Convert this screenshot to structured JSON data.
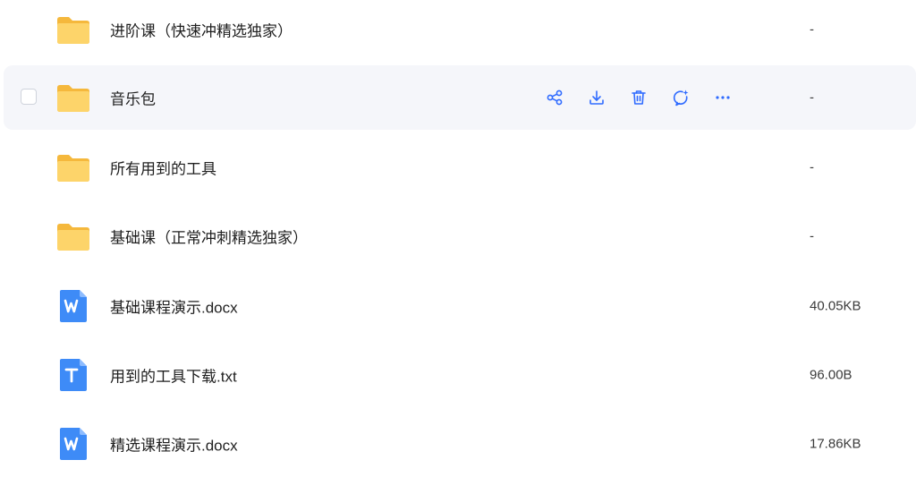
{
  "accent_color": "#2f6bff",
  "hovered_row_actions": [
    {
      "name": "share-icon"
    },
    {
      "name": "download-icon"
    },
    {
      "name": "delete-icon"
    },
    {
      "name": "ai-assistant-icon"
    },
    {
      "name": "more-icon"
    }
  ],
  "files": [
    {
      "name": "进阶课（快速冲精选独家）",
      "size": "-",
      "type": "folder-icon"
    },
    {
      "name": "音乐包",
      "size": "-",
      "type": "folder-icon"
    },
    {
      "name": "所有用到的工具",
      "size": "-",
      "type": "folder-icon"
    },
    {
      "name": "基础课（正常冲刺精选独家）",
      "size": "-",
      "type": "folder-icon"
    },
    {
      "name": "基础课程演示.docx",
      "size": "40.05KB",
      "type": "word-doc-icon"
    },
    {
      "name": "用到的工具下载.txt",
      "size": "96.00B",
      "type": "text-file-icon"
    },
    {
      "name": "精选课程演示.docx",
      "size": "17.86KB",
      "type": "word-doc-icon"
    }
  ]
}
